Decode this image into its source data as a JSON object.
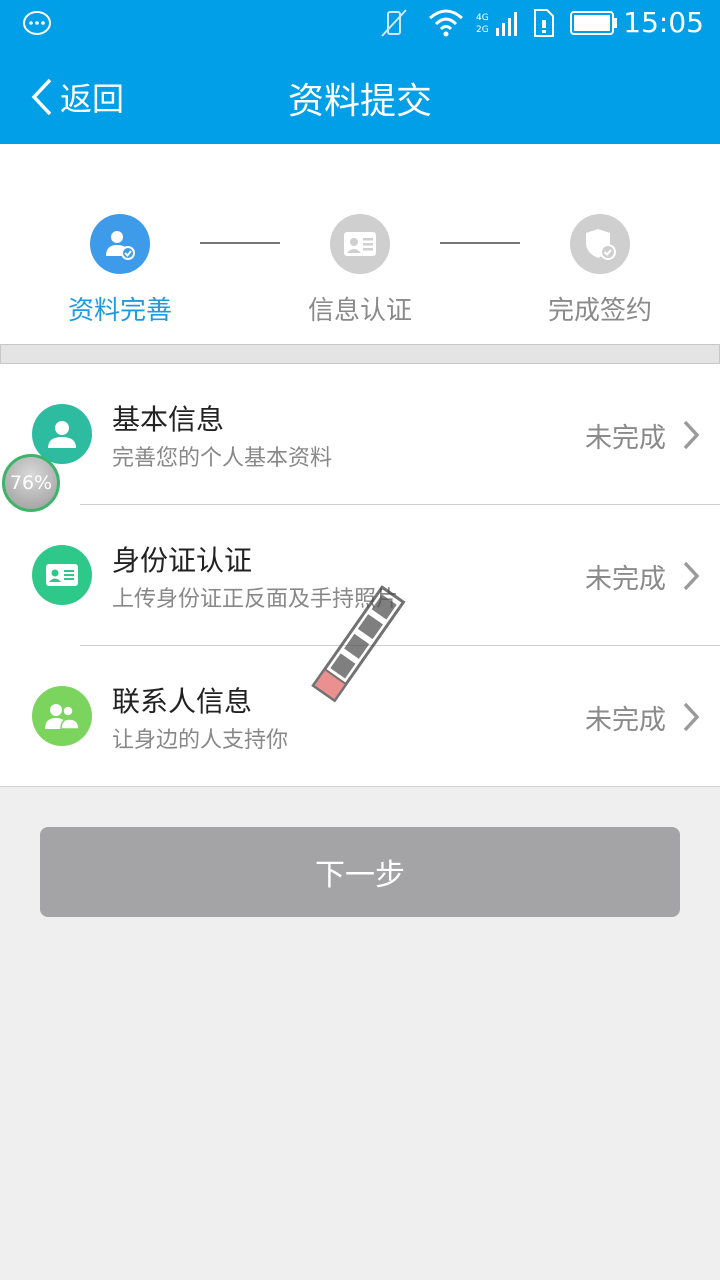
{
  "status_bar": {
    "time": "15:05",
    "network_top": "4G",
    "network_bottom": "2G"
  },
  "header": {
    "back_label": "返回",
    "title": "资料提交"
  },
  "steps": [
    {
      "label": "资料完善",
      "state": "active",
      "icon": "user-check-icon",
      "color": "#3d9be9"
    },
    {
      "label": "信息认证",
      "state": "inactive",
      "icon": "id-card-icon",
      "color": "#cfcfcf"
    },
    {
      "label": "完成签约",
      "state": "inactive",
      "icon": "shield-check-icon",
      "color": "#cfcfcf"
    }
  ],
  "items": [
    {
      "title": "基本信息",
      "subtitle": "完善您的个人基本资料",
      "status": "未完成",
      "icon": "person-icon",
      "color": "#2ebca0"
    },
    {
      "title": "身份证认证",
      "subtitle": "上传身份证正反面及手持照片",
      "status": "未完成",
      "icon": "id-card-icon",
      "color": "#2ec98a"
    },
    {
      "title": "联系人信息",
      "subtitle": "让身边的人支持你",
      "status": "未完成",
      "icon": "contacts-icon",
      "color": "#7bd45e"
    }
  ],
  "next_button": {
    "label": "下一步",
    "color": "#a4a4a6"
  },
  "overlay": {
    "progress_text": "76%"
  },
  "colors": {
    "primary": "#009fe8",
    "active_text": "#1e9be0"
  }
}
